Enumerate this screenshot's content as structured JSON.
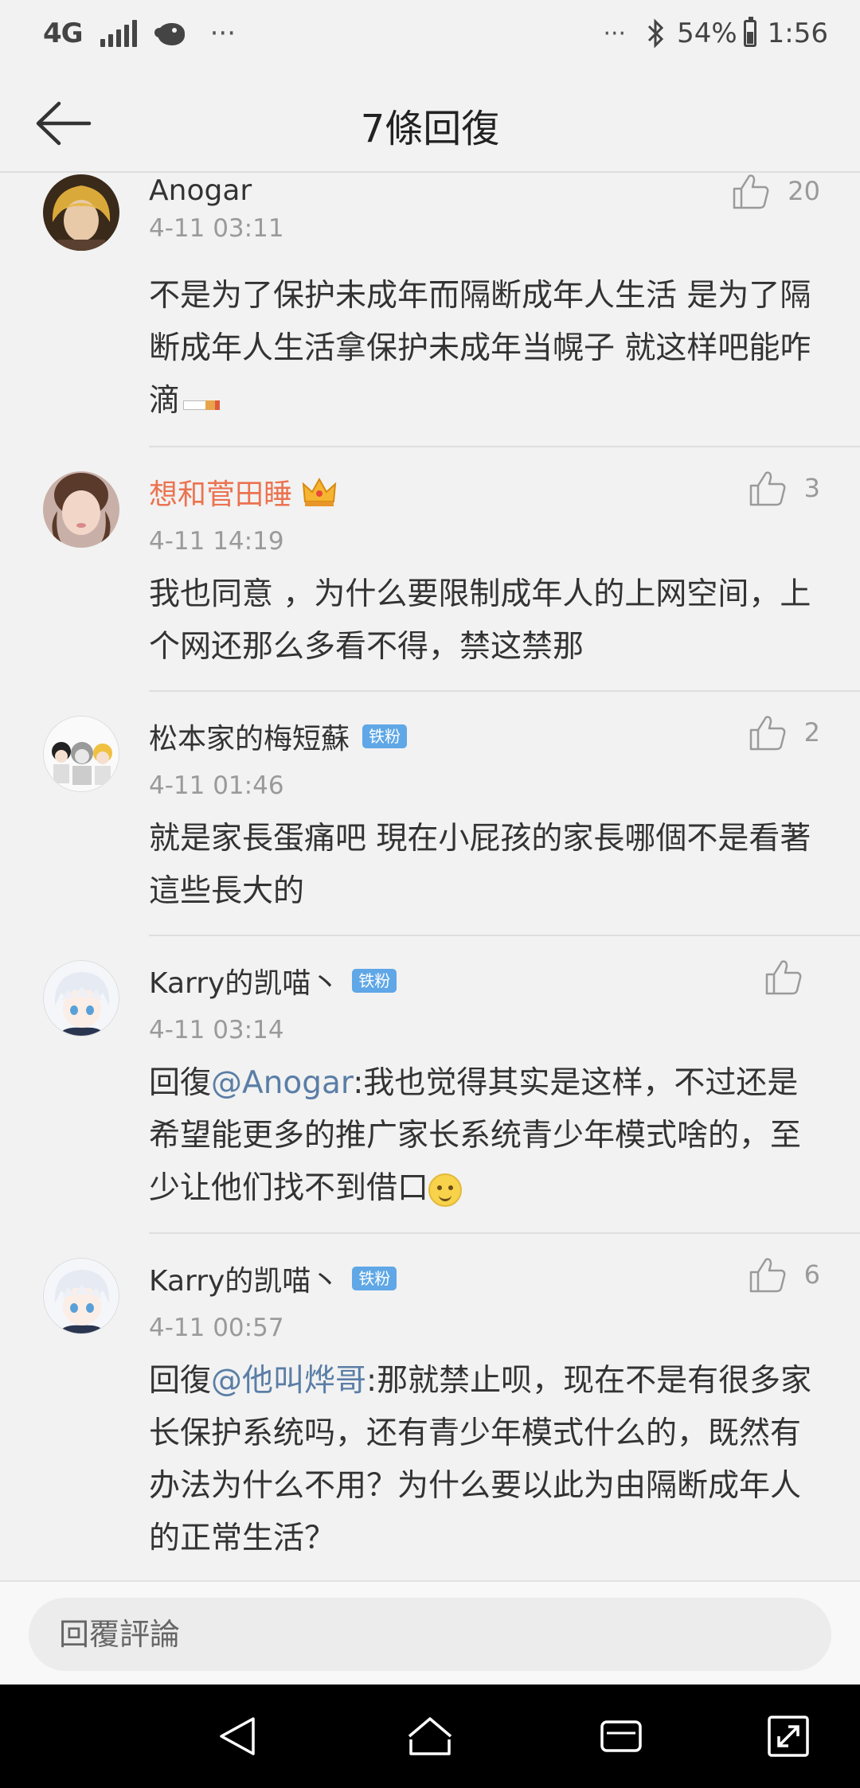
{
  "status_bar": {
    "network": "4G",
    "more": "···",
    "notif_dots": "···",
    "battery": "54%",
    "time": "1:56"
  },
  "header": {
    "title": "7條回復"
  },
  "comments": [
    {
      "name": "Anogar",
      "time": "4-11 03:11",
      "likes": "20",
      "text": "不是为了保护未成年而隔断成年人生活 是为了隔断成年人生活拿保护未成年当幌子 就这样吧能咋滴",
      "avatar": "avatar-anogar"
    },
    {
      "name": "想和菅田睡",
      "time": "4-11 14:19",
      "likes": "3",
      "text": "我也同意 ，为什么要限制成年人的上网空间，上个网还那么多看不得，禁这禁那",
      "avatar": "avatar-girl"
    },
    {
      "name": "松本家的梅短蘇",
      "badge": "铁粉",
      "time": "4-11 01:46",
      "likes": "2",
      "text": "就是家長蛋痛吧 現在小屁孩的家長哪個不是看著這些長大的",
      "avatar": "avatar-group"
    },
    {
      "name": "Karry的凯喵丶",
      "badge": "铁粉",
      "time": "4-11 03:14",
      "likes": "",
      "reply_prefix": "回復",
      "mention": "@Anogar",
      "text": ":我也觉得其实是这样，不过还是希望能更多的推广家长系统青少年模式啥的，至少让他们找不到借口",
      "avatar": "avatar-anime"
    },
    {
      "name": "Karry的凯喵丶",
      "badge": "铁粉",
      "time": "4-11 00:57",
      "likes": "6",
      "reply_prefix": "回復",
      "mention": "@他叫烨哥",
      "text": ":那就禁止呗，现在不是有很多家长保护系统吗，还有青少年模式什么的，既然有办法为什么不用？为什么要以此为由隔断成年人的正常生活？",
      "avatar": "avatar-anime"
    }
  ],
  "reply_bar": {
    "placeholder": "回覆評論"
  },
  "colors": {
    "background": "#f2f2f2",
    "vip_name": "#eb7350",
    "mention": "#5a7ea6",
    "badge": "#5fa7e6",
    "meta": "#9a9a9a"
  },
  "icons": {
    "back": "arrow-left-icon",
    "like": "thumbs-up-icon",
    "crown": "crown-icon",
    "nav_back": "triangle-back-icon",
    "nav_home": "home-icon",
    "nav_recent": "recent-apps-icon",
    "nav_expand": "expand-icon"
  }
}
